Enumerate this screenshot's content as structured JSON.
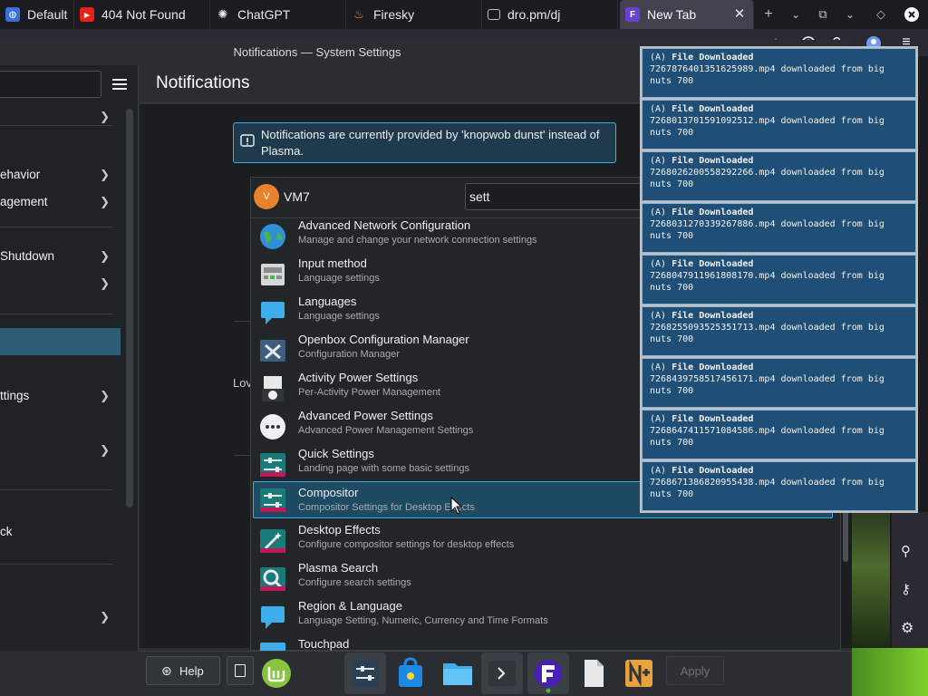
{
  "browser": {
    "tabs": [
      {
        "label": "Default",
        "icon": "globe-icon"
      },
      {
        "label": "404 Not Found",
        "icon": "youtube-icon"
      },
      {
        "label": "ChatGPT",
        "icon": "chatgpt-icon"
      },
      {
        "label": "Firesky",
        "icon": "flame-icon"
      },
      {
        "label": "dro.pm/dj",
        "icon": "file-icon"
      },
      {
        "label": "New Tab",
        "icon": "firefox-icon",
        "active": true
      }
    ]
  },
  "window": {
    "title": "Notifications — System Settings"
  },
  "sidebar": {
    "items": [
      {
        "label": "",
        "chevron": true
      },
      {
        "label": "ehavior",
        "chevron": true
      },
      {
        "label": "agement",
        "chevron": true
      },
      {
        "label": "Shutdown",
        "chevron": true
      },
      {
        "label": "",
        "chevron": true
      },
      {
        "label": "",
        "chevron": false,
        "selected": true
      },
      {
        "label": "ttings",
        "chevron": true
      },
      {
        "label": "",
        "chevron": true
      },
      {
        "label": "ck",
        "chevron": false
      },
      {
        "label": "",
        "chevron": true
      }
    ]
  },
  "main": {
    "title": "Notifications",
    "notice": "Notifications are currently provided by 'knopwob dunst' instead of Plasma.",
    "partial_label": "Lov"
  },
  "runner": {
    "user_initial": "V",
    "user_name": "VM7",
    "query": "sett",
    "results": [
      {
        "title": "Advanced Network Configuration",
        "subtitle": "Manage and change your network connection settings",
        "icon": "globe-icon"
      },
      {
        "title": "Input method",
        "subtitle": "Language settings",
        "icon": "keyboard-icon"
      },
      {
        "title": "Languages",
        "subtitle": "Language settings",
        "icon": "speech-bubble-icon"
      },
      {
        "title": "Openbox Configuration Manager",
        "subtitle": "Configuration Manager",
        "icon": "tools-icon"
      },
      {
        "title": "Activity Power Settings",
        "subtitle": "Per-Activity Power Management",
        "icon": "activity-power-icon"
      },
      {
        "title": "Advanced Power Settings",
        "subtitle": "Advanced Power Management Settings",
        "icon": "more-icon"
      },
      {
        "title": "Quick Settings",
        "subtitle": "Landing page with some basic settings",
        "icon": "sliders-icon"
      },
      {
        "title": "Compositor",
        "subtitle": "Compositor Settings for Desktop Effects",
        "icon": "sliders-icon",
        "selected": true
      },
      {
        "title": "Desktop Effects",
        "subtitle": "Configure compositor settings for desktop effects",
        "icon": "magic-wand-icon"
      },
      {
        "title": "Plasma Search",
        "subtitle": "Configure search settings",
        "icon": "magnifier-icon"
      },
      {
        "title": "Region & Language",
        "subtitle": "Language Setting, Numeric, Currency and Time Formats",
        "icon": "speech-bubble-icon"
      },
      {
        "title": "Touchpad",
        "subtitle": "",
        "icon": "touchpad-icon"
      }
    ]
  },
  "buttons": {
    "help": "Help",
    "apply": "Apply"
  },
  "notifications": [
    {
      "prefix": "(A) ",
      "title": "File Downloaded",
      "line1": "7267876401351625989.mp4 downloaded from big",
      "line2": "nuts 700"
    },
    {
      "prefix": "(A) ",
      "title": "File Downloaded",
      "line1": "7268013701591092512.mp4 downloaded from big",
      "line2": "nuts 700"
    },
    {
      "prefix": "(A) ",
      "title": "File Downloaded",
      "line1": "7268026200558292266.mp4 downloaded from big",
      "line2": "nuts 700"
    },
    {
      "prefix": "(A) ",
      "title": "File Downloaded",
      "line1": "7268031270339267886.mp4 downloaded from big",
      "line2": "nuts 700"
    },
    {
      "prefix": "(A) ",
      "title": "File Downloaded",
      "line1": "7268047911961808170.mp4 downloaded from big",
      "line2": "nuts 700"
    },
    {
      "prefix": "(A) ",
      "title": "File Downloaded",
      "line1": "7268255093525351713.mp4 downloaded from big",
      "line2": "nuts 700"
    },
    {
      "prefix": "(A) ",
      "title": "File Downloaded",
      "line1": "7268439758517456171.mp4 downloaded from big",
      "line2": "nuts 700"
    },
    {
      "prefix": "(A) ",
      "title": "File Downloaded",
      "line1": "7268647411571084586.mp4 downloaded from big",
      "line2": "nuts 700"
    },
    {
      "prefix": "(A) ",
      "title": "File Downloaded",
      "line1": "7268671386820955438.mp4 downloaded from big",
      "line2": "nuts 700"
    }
  ],
  "dock": [
    {
      "name": "linux-mint-icon"
    },
    {
      "name": "settings-sliders-icon",
      "active": true
    },
    {
      "name": "software-store-icon"
    },
    {
      "name": "file-manager-icon"
    },
    {
      "name": "terminal-icon",
      "active": true
    },
    {
      "name": "firefox-icon",
      "active": true
    },
    {
      "name": "text-file-icon"
    },
    {
      "name": "app-plus-icon"
    }
  ],
  "colors": {
    "accent": "#3daee9",
    "selection": "#1e4a63",
    "notification_bg": "#1f4f76",
    "window_bg": "#2a2e32"
  }
}
